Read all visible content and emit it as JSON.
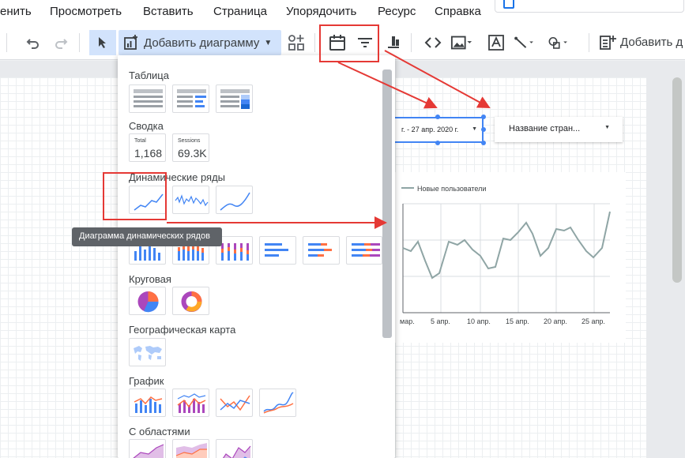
{
  "menu": {
    "items": [
      "енить",
      "Просмотреть",
      "Вставить",
      "Страница",
      "Упорядочить",
      "Ресурс",
      "Справка"
    ]
  },
  "toolbar": {
    "add_chart_label": "Добавить диаграмму",
    "add_field_label": "Добавить д",
    "icons": [
      "undo-icon",
      "redo-icon",
      "pointer-icon",
      "add-chart-icon",
      "add-controls-icon",
      "calendar-icon",
      "filter-icon",
      "sort-icon",
      "code-icon",
      "image-icon",
      "text-icon",
      "line-icon",
      "shape-icon",
      "add-field-icon"
    ]
  },
  "canvas": {
    "date_control_text": "г. - 27 апр. 2020 г.",
    "page_filter_text": "Название стран...",
    "chart": {
      "legend": "Новые пользователи",
      "x_ticks": [
        "мар.",
        "5 апр.",
        "10 апр.",
        "15 апр.",
        "20 апр.",
        "25 апр."
      ],
      "series_color": "#8fa5a5"
    }
  },
  "panel": {
    "sections": {
      "table": "Таблица",
      "scorecard": "Сводка",
      "timeseries": "Динамические ряды",
      "pie": "Круговая",
      "geo": "Географическая карта",
      "line": "График",
      "area": "С областями"
    },
    "scorecards": [
      {
        "label": "Total",
        "value": "1,168"
      },
      {
        "label": "Sessions",
        "value": "69.3K"
      }
    ],
    "tooltip": "Диаграмма динамических рядов"
  },
  "colors": {
    "accent": "#4285f4",
    "annotation": "#e53935",
    "selected_bg": "#d2e3fc"
  }
}
